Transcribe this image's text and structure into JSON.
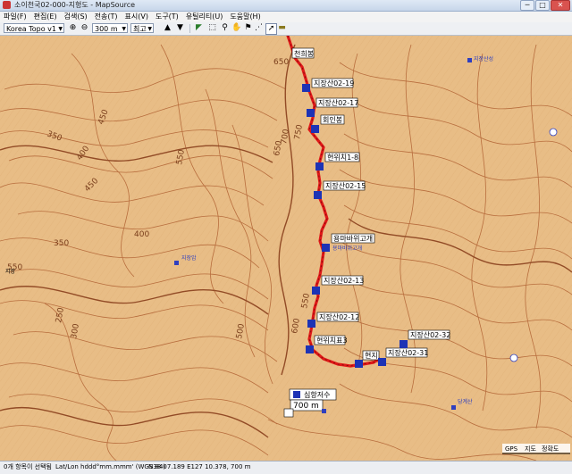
{
  "window": {
    "title": "소이천국02-000-지형도 - MapSource",
    "buttons": {
      "minimize": "─",
      "maximize": "□",
      "close": "✕"
    }
  },
  "menu": [
    "파일(F)",
    "편집(E)",
    "검색(S)",
    "전송(T)",
    "표시(V)",
    "도구(T)",
    "유틸리티(U)",
    "도움말(H)"
  ],
  "toolbar": {
    "map_product": "Korea Topo v1 ",
    "scale": "300 m",
    "detail": "최고"
  },
  "map": {
    "colors": {
      "terrain": "#e9bf88",
      "contour": "#b66b3c",
      "index_contour": "#96502a",
      "track": "#e21b1b",
      "water_label": "#2f3fbf",
      "waypoint_icon": "#1d33b5"
    },
    "contour_labels": [
      "650",
      "450",
      "350",
      "400",
      "450",
      "550",
      "700",
      "750",
      "650",
      "550",
      "250",
      "300",
      "350",
      "400",
      "500",
      "600",
      "550"
    ],
    "waypoints": [
      {
        "label": "천희봉",
        "icon": "waypoint-icon"
      },
      {
        "label": "지장산02-19",
        "icon": "hiker-icon"
      },
      {
        "label": "지장산02-17",
        "icon": "hiker-icon"
      },
      {
        "label": "회인봉",
        "icon": "hiker-icon"
      },
      {
        "label": "현위치1-8",
        "icon": "hiker-icon"
      },
      {
        "label": "지장산02-15",
        "icon": "hiker-icon"
      },
      {
        "label": "용마바위고개",
        "icon": "hiker-icon"
      },
      {
        "label": "지장산02-13",
        "icon": "hiker-icon"
      },
      {
        "label": "지장산02-12",
        "icon": "hiker-icon"
      },
      {
        "label": "현위치표3",
        "icon": "hiker-icon"
      },
      {
        "label": "현지",
        "icon": "hiker-icon"
      },
      {
        "label": "지장산02-31",
        "icon": "hiker-icon"
      },
      {
        "label": "지장산02-32",
        "icon": "hiker-icon"
      }
    ],
    "poi_labels": [
      "지장산성",
      "용마바위고개",
      "지장암",
      "지장",
      "당계산"
    ],
    "lake_label": "심항저수",
    "elevation_label": "700 m",
    "scale_labels": [
      "GPS",
      "지도",
      "정확도"
    ]
  },
  "status": {
    "selection": "0개 항목이 선택됨",
    "format": "Lat/Lon hddd°mm.mmm' (WGS 84)",
    "coordinates": "N38 07.189 E127 10.378, 700 m"
  }
}
